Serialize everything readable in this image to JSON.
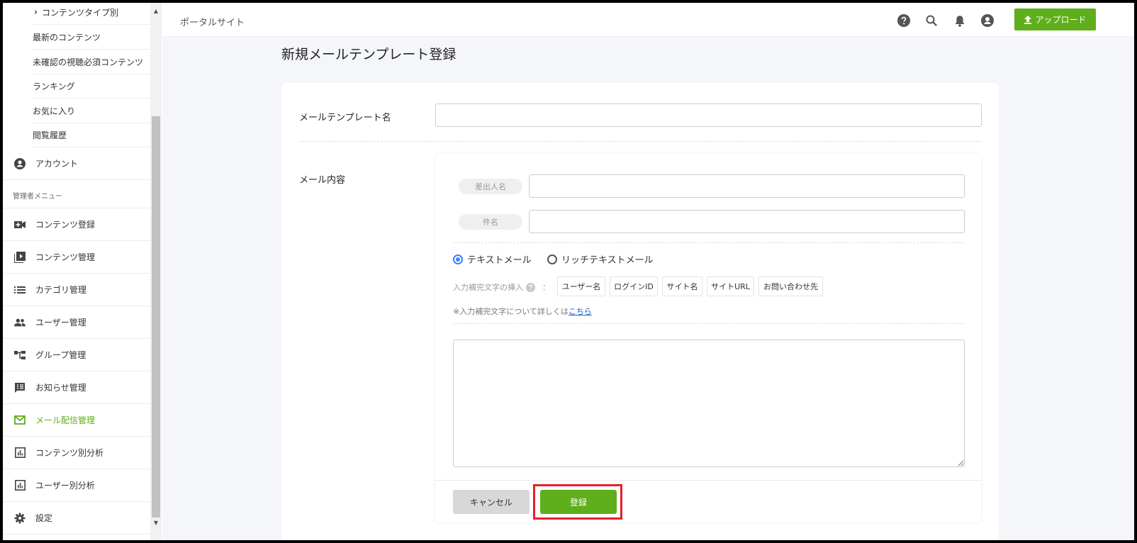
{
  "colors": {
    "accent": "#5fae1b",
    "highlight": "#e5202b",
    "link": "#1a5bc4"
  },
  "sidebar": {
    "sub_items": [
      {
        "label": "コンテンツタイプ別",
        "icon": "chevron-right-icon"
      },
      {
        "label": "最新のコンテンツ"
      },
      {
        "label": "未確認の視聴必須コンテンツ"
      },
      {
        "label": "ランキング"
      },
      {
        "label": "お気に入り"
      },
      {
        "label": "閲覧履歴"
      }
    ],
    "account_label": "アカウント",
    "admin_section": "管理者メニュー",
    "admin_items": [
      {
        "label": "コンテンツ登録",
        "icon": "video-add-icon"
      },
      {
        "label": "コンテンツ管理",
        "icon": "playlist-icon"
      },
      {
        "label": "カテゴリ管理",
        "icon": "list-icon"
      },
      {
        "label": "ユーザー管理",
        "icon": "users-icon"
      },
      {
        "label": "グループ管理",
        "icon": "group-tree-icon"
      },
      {
        "label": "お知らせ管理",
        "icon": "announcement-icon"
      },
      {
        "label": "メール配信管理",
        "icon": "mail-icon",
        "active": true
      },
      {
        "label": "コンテンツ別分析",
        "icon": "chart-icon"
      },
      {
        "label": "ユーザー別分析",
        "icon": "chart-icon"
      },
      {
        "label": "設定",
        "icon": "gear-icon"
      }
    ]
  },
  "header": {
    "site_title": "ポータルサイト",
    "icons": [
      "help-icon",
      "search-icon",
      "bell-icon",
      "user-icon"
    ],
    "upload_label": "アップロード"
  },
  "page": {
    "title": "新規メールテンプレート登録",
    "template_name_label": "メールテンプレート名",
    "template_name_value": "",
    "mail_content_label": "メール内容",
    "sender_label": "差出人名",
    "sender_value": "",
    "subject_label": "件名",
    "subject_value": "",
    "radio_text": "テキストメール",
    "radio_rich": "リッチテキストメール",
    "insert_label": "入力補完文字の挿入",
    "insert_separator": "：",
    "insert_buttons": [
      "ユーザー名",
      "ログインID",
      "サイト名",
      "サイトURL",
      "お問い合わせ先"
    ],
    "note_prefix": "※入力補完文字について詳しくは",
    "note_link": "こちら",
    "body_value": "",
    "cancel_label": "キャンセル",
    "register_label": "登録"
  }
}
